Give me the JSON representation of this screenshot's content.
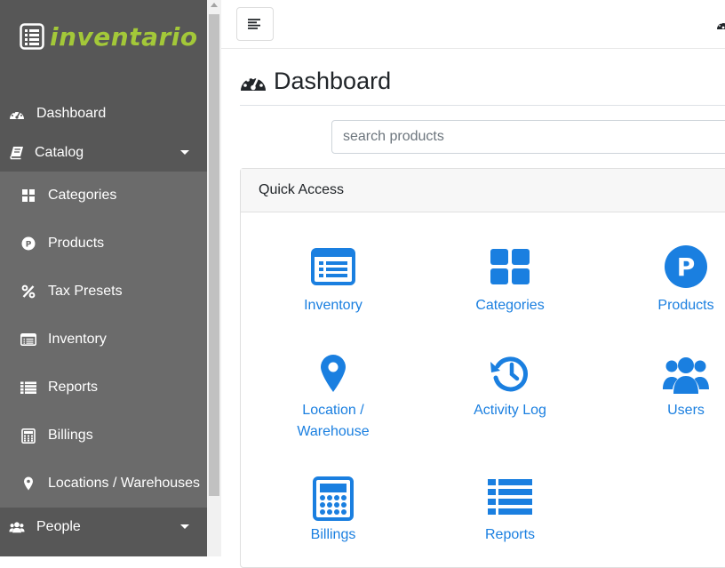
{
  "brand": {
    "name": "inventario",
    "color": "#a3c839"
  },
  "sidebar": {
    "items": [
      {
        "label": "Dashboard",
        "icon": "dashboard-gauge-icon"
      },
      {
        "label": "Catalog",
        "icon": "book-icon"
      }
    ],
    "catalog_submenu": [
      {
        "label": "Categories",
        "icon": "grid-icon"
      },
      {
        "label": "Products",
        "icon": "product-p-icon"
      },
      {
        "label": "Tax Presets",
        "icon": "percent-icon"
      },
      {
        "label": "Inventory",
        "icon": "list-card-icon"
      },
      {
        "label": "Reports",
        "icon": "list-icon"
      },
      {
        "label": "Billings",
        "icon": "calculator-icon"
      },
      {
        "label": "Locations / Warehouses",
        "icon": "map-marker-icon"
      }
    ],
    "people": {
      "label": "People",
      "icon": "users-icon"
    }
  },
  "main": {
    "title": "Dashboard",
    "search_placeholder": "search products",
    "quick_access": {
      "title": "Quick Access",
      "tiles": [
        {
          "label": "Inventory",
          "icon": "list-card-icon"
        },
        {
          "label": "Categories",
          "icon": "grid-icon"
        },
        {
          "label": "Products",
          "icon": "product-p-icon"
        },
        {
          "label_line1": "Location /",
          "label_line2": "Warehouse",
          "icon": "map-marker-icon"
        },
        {
          "label": "Activity Log",
          "icon": "history-icon"
        },
        {
          "label": "Users",
          "icon": "users-icon"
        },
        {
          "label": "Billings",
          "icon": "calculator-icon"
        },
        {
          "label": "Reports",
          "icon": "list-icon"
        }
      ]
    }
  },
  "colors": {
    "sidebar": "#575757",
    "submenu": "#6b6b6b",
    "accent": "#1a7fe0"
  }
}
